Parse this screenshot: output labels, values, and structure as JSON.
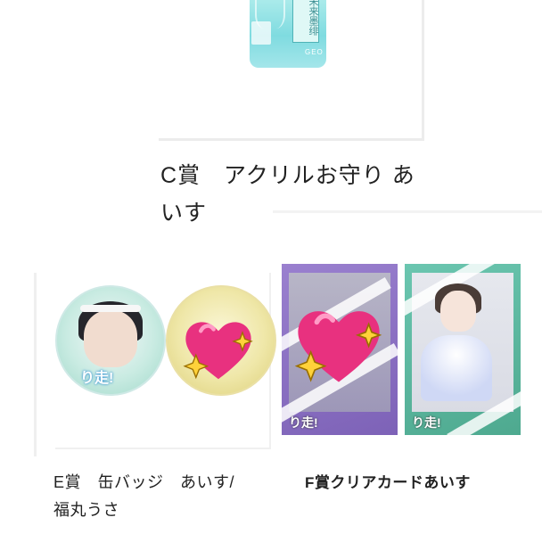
{
  "prizes": {
    "c": {
      "title_line1": "C賞　アクリルお守り あ",
      "title_line2": "いす",
      "amulet_text": "未来墨绯",
      "amulet_brand": "GEO"
    },
    "e": {
      "title_line1": "E賞　缶バッジ　あいす/",
      "title_line2": "福丸うさ",
      "badge_logo": "り走!"
    },
    "f": {
      "title": "F賞クリアカードあいす",
      "card_logo": "り走!"
    }
  },
  "stickers": {
    "icon": "sparkling-heart-icon",
    "heart_color": "#e8317f",
    "sparkle_color": "#ffd23a"
  }
}
